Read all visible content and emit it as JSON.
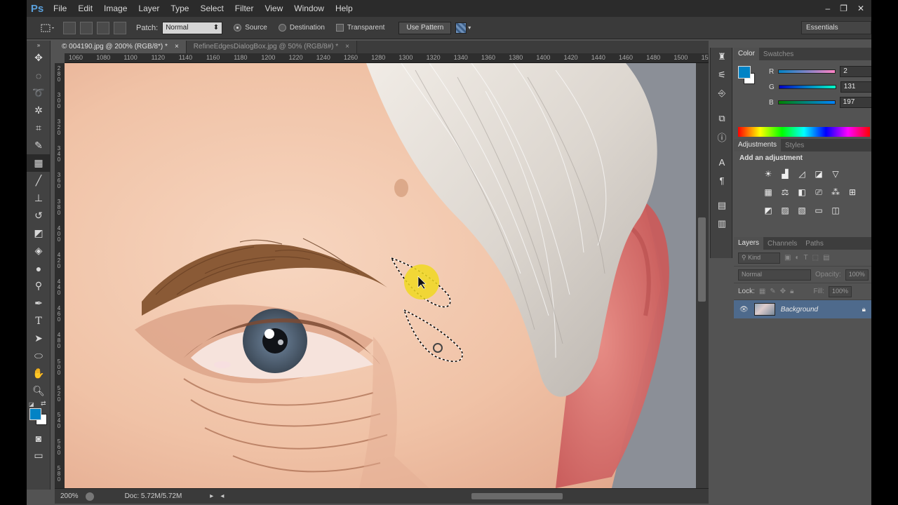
{
  "app": {
    "logo": "Ps",
    "window_controls": [
      "–",
      "❐",
      "✕"
    ]
  },
  "menu": [
    "File",
    "Edit",
    "Image",
    "Layer",
    "Type",
    "Select",
    "Filter",
    "View",
    "Window",
    "Help"
  ],
  "options": {
    "patch_label": "Patch:",
    "patch_value": "Normal",
    "source_label": "Source",
    "destination_label": "Destination",
    "transparent_label": "Transparent",
    "use_pattern_label": "Use Pattern",
    "workspace": "Essentials"
  },
  "doc_tabs": [
    {
      "label": "© 004190.jpg @ 200% (RGB/8*) *",
      "close": "×"
    },
    {
      "label": "RefineEdgesDialogBox.jpg @ 50% (RGB/8#) *",
      "close": "×"
    }
  ],
  "ruler_top": [
    "1060",
    "1080",
    "1100",
    "1120",
    "1140",
    "1160",
    "1180",
    "1200",
    "1220",
    "1240",
    "1260",
    "1280",
    "1300",
    "1320",
    "1340",
    "1360",
    "1380",
    "1400",
    "1420",
    "1440",
    "1460",
    "1480",
    "1500",
    "15"
  ],
  "ruler_left": [
    "2 8 0",
    "3 0 0",
    "3 2 0",
    "3 4 0",
    "3 6 0",
    "3 8 0",
    "4 0 0",
    "4 2 0",
    "4 4 0",
    "4 6 0",
    "4 8 0",
    "5 0 0",
    "5 2 0",
    "5 4 0",
    "5 6 0",
    "5 8 0"
  ],
  "status": {
    "zoom": "200%",
    "doc": "Doc: 5.72M/5.72M"
  },
  "color_panel": {
    "tabs": [
      "Color",
      "Swatches"
    ],
    "fg_color": "#0283c5",
    "channels": [
      {
        "label": "R",
        "value": "2"
      },
      {
        "label": "G",
        "value": "131"
      },
      {
        "label": "B",
        "value": "197"
      }
    ]
  },
  "adjustments_panel": {
    "tabs": [
      "Adjustments",
      "Styles"
    ],
    "heading": "Add an adjustment"
  },
  "layers_panel": {
    "tabs": [
      "Layers",
      "Channels",
      "Paths"
    ],
    "kind": "Kind",
    "blend_mode": "Normal",
    "opacity_label": "Opacity:",
    "opacity_value": "100%",
    "lock_label": "Lock:",
    "fill_label": "Fill:",
    "fill_value": "100%",
    "layer_name": "Background"
  }
}
